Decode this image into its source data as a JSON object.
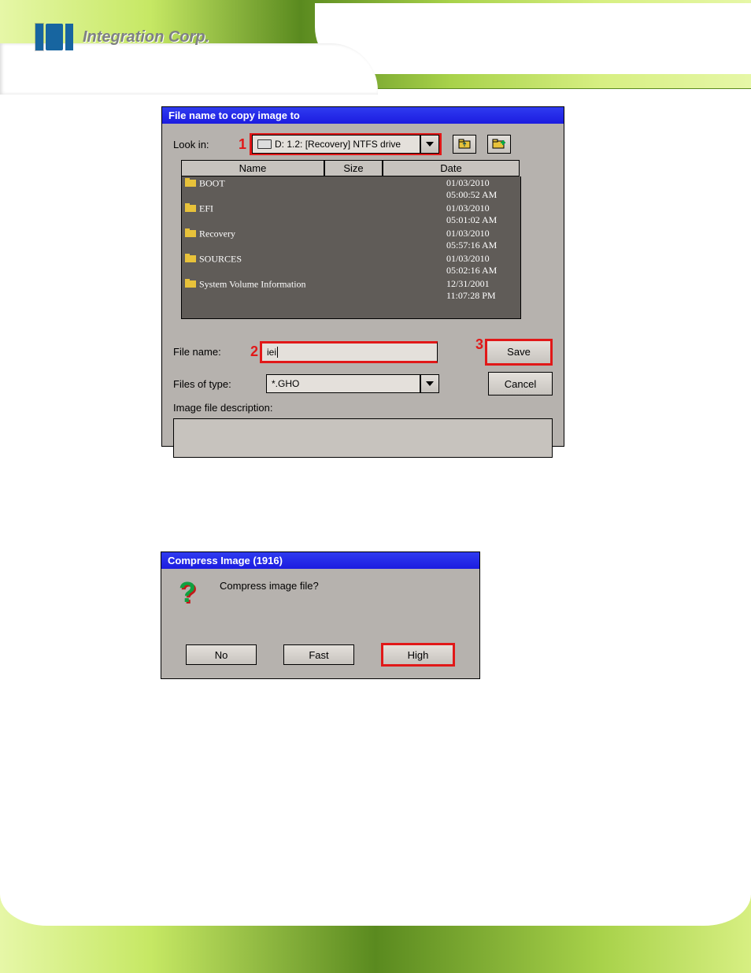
{
  "brand": {
    "logo_text": "Integration Corp."
  },
  "saveDialog": {
    "title": "File name to copy image to",
    "lookIn": {
      "label": "Look in:",
      "value": "D: 1.2: [Recovery] NTFS drive"
    },
    "headers": {
      "name": "Name",
      "size": "Size",
      "date": "Date"
    },
    "files": [
      {
        "name": "BOOT",
        "date": "01/03/2010 05:00:52 AM"
      },
      {
        "name": "EFI",
        "date": "01/03/2010 05:01:02 AM"
      },
      {
        "name": "Recovery",
        "date": "01/03/2010 05:57:16 AM"
      },
      {
        "name": "SOURCES",
        "date": "01/03/2010 05:02:16 AM"
      },
      {
        "name": "System Volume Information",
        "date": "12/31/2001 11:07:28 PM"
      }
    ],
    "fileName": {
      "label": "File name:",
      "value": "iei"
    },
    "filesOfType": {
      "label": "Files of type:",
      "value": "*.GHO"
    },
    "description_label": "Image file description:",
    "save": "Save",
    "cancel": "Cancel",
    "callouts": {
      "one": "1",
      "two": "2",
      "three": "3"
    }
  },
  "compressDialog": {
    "title": "Compress Image (1916)",
    "message": "Compress image file?",
    "buttons": {
      "no": "No",
      "fast": "Fast",
      "high": "High"
    }
  }
}
